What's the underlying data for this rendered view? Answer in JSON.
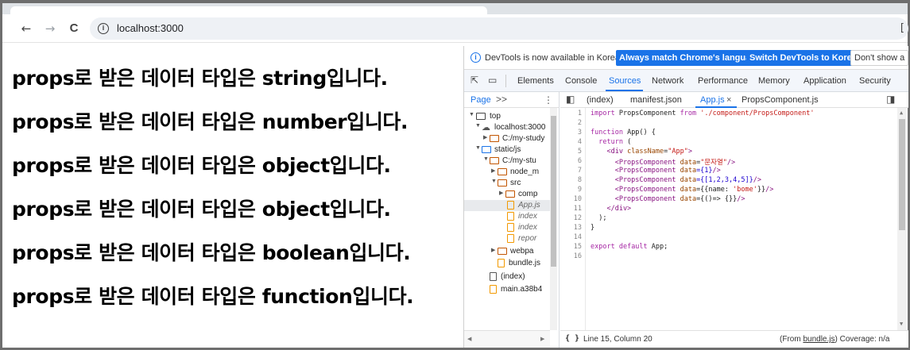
{
  "browser": {
    "url": "localhost:3000",
    "back_glyph": "←",
    "forward_glyph": "→",
    "reload_glyph": "C",
    "info_glyph": "i",
    "edge_glyph": "["
  },
  "page": {
    "lines": [
      "props로 받은 데이터 타입은 string입니다.",
      "props로 받은 데이터 타입은 number입니다.",
      "props로 받은 데이터 타입은 object입니다.",
      "props로 받은 데이터 타입은 object입니다.",
      "props로 받은 데이터 타입은 boolean입니다.",
      "props로 받은 데이터 타입은 function입니다."
    ]
  },
  "devtools": {
    "infobar": {
      "message": "DevTools is now available in Korean!",
      "always_match": "Always match Chrome's language",
      "switch": "Switch DevTools to Korean",
      "dont_show": "Don't show a"
    },
    "tabs": [
      "Elements",
      "Console",
      "Sources",
      "Network",
      "Performance",
      "Memory",
      "Application",
      "Security"
    ],
    "active_tab": "Sources",
    "navigator": {
      "header": "Page",
      "more": ">>",
      "kebab": "⋮",
      "tree": [
        "top",
        "localhost:3000",
        "C:/my-study",
        "static/js",
        "C:/my-stu",
        "node_m",
        "src",
        "comp",
        "App.js",
        "index",
        "index",
        "repor",
        "webpa",
        "bundle.js",
        "(index)",
        "main.a38b4"
      ]
    },
    "editor": {
      "tabs": [
        "(index)",
        "manifest.json",
        "App.js",
        "PropsComponent.js"
      ],
      "active_tab": "App.js",
      "close_glyph": "×",
      "line_numbers": [
        "1",
        "2",
        "3",
        "4",
        "5",
        "6",
        "7",
        "8",
        "9",
        "10",
        "11",
        "12",
        "13",
        "14",
        "15",
        "16"
      ],
      "code": {
        "l1_kw1": "import",
        "l1_name": " PropsComponent ",
        "l1_kw2": "from",
        "l1_str": " './component/PropsComponent'",
        "l3_kw": "function",
        "l3_rest": " App() {",
        "l4_kw": "  return",
        "l4_rest": " (",
        "l5_tag": "    <div",
        "l5_attr": " className",
        "l5_eq": "=",
        "l5_str": "\"App\"",
        "l5_close": ">",
        "l6_tag": "      <PropsComponent",
        "l6_attr": " data",
        "l6_eq": "=",
        "l6_str": "\"문자열\"",
        "l6_close": "/>",
        "l7_tag": "      <PropsComponent",
        "l7_attr": " data",
        "l7_val": "={1}",
        "l7_close": "/>",
        "l8_tag": "      <PropsComponent",
        "l8_attr": " data",
        "l8_val": "={[1,2,3,4,5]}",
        "l8_close": "/>",
        "l9_tag": "      <PropsComponent",
        "l9_attr": " data",
        "l9_val1": "={{name: ",
        "l9_str": "'bome'",
        "l9_val2": "}}",
        "l9_close": "/>",
        "l10_tag": "      <PropsComponent",
        "l10_attr": " data",
        "l10_val": "={()=> {}}",
        "l10_close": "/>",
        "l11_tag": "    </div>",
        "l12": "  );",
        "l13": "}",
        "l15_kw1": "export",
        "l15_kw2": " default",
        "l15_rest": " App;"
      }
    },
    "status": {
      "braces": "{ }",
      "position": "Line 15, Column 20",
      "from_prefix": "(From ",
      "from_file": "bundle.js",
      "from_suffix": ") Coverage: n/a"
    }
  }
}
